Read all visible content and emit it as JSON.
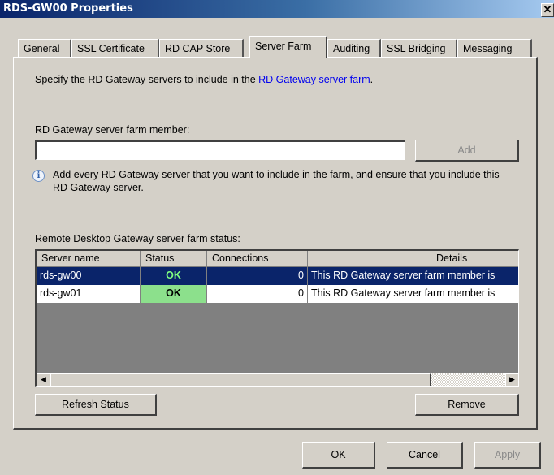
{
  "window": {
    "title": "RDS-GW00 Properties",
    "close_glyph": "✕"
  },
  "tabs": [
    {
      "label": "General",
      "active": false
    },
    {
      "label": "SSL Certificate",
      "active": false
    },
    {
      "label": "RD CAP Store",
      "active": false
    },
    {
      "label": "Server Farm",
      "active": true
    },
    {
      "label": "Auditing",
      "active": false
    },
    {
      "label": "SSL Bridging",
      "active": false
    },
    {
      "label": "Messaging",
      "active": false
    }
  ],
  "panel": {
    "intro_prefix": "Specify the RD Gateway servers to include in the ",
    "intro_link": "RD Gateway server farm",
    "intro_suffix": ".",
    "member_label": "RD Gateway server farm member:",
    "member_value": "",
    "add_label": "Add",
    "hint": "Add every RD Gateway server that you want to include in the farm, and ensure that you include this RD Gateway server.",
    "status_label": "Remote Desktop Gateway server farm status:",
    "columns": [
      "Server name",
      "Status",
      "Connections",
      "Details"
    ],
    "rows": [
      {
        "server": "rds-gw00",
        "status": "OK",
        "connections": "0",
        "details": "This RD Gateway server farm member is",
        "selected": true
      },
      {
        "server": "rds-gw01",
        "status": "OK",
        "connections": "0",
        "details": "This RD Gateway server farm member is",
        "selected": false
      }
    ],
    "scroll_left_glyph": "◀",
    "scroll_right_glyph": "▶",
    "refresh_label": "Refresh Status",
    "remove_label": "Remove"
  },
  "footer": {
    "ok_label": "OK",
    "cancel_label": "Cancel",
    "apply_label": "Apply"
  },
  "colors": {
    "selection": "#0a246a",
    "status_ok_bg": "#8ce08c",
    "link": "#0000ee",
    "face": "#d4d0c8"
  },
  "icons": {
    "info": "info-icon"
  }
}
